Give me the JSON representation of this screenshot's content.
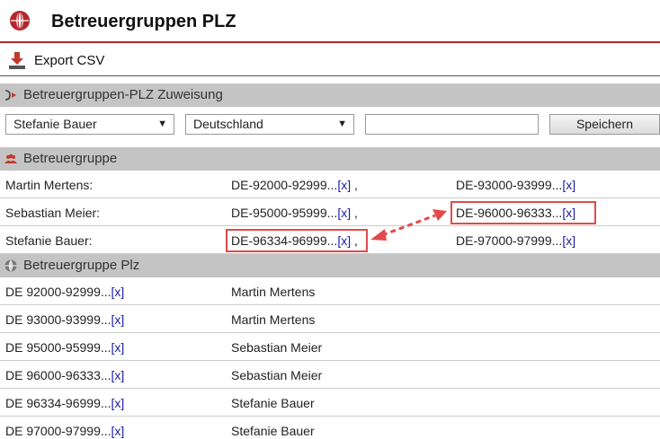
{
  "header": {
    "title": "Betreuergruppen PLZ"
  },
  "toolbar": {
    "export_label": "Export CSV"
  },
  "assign_section": {
    "label": "Betreuergruppen-PLZ Zuweisung"
  },
  "form": {
    "person_select": {
      "value": "Stefanie Bauer"
    },
    "country_select": {
      "value": "Deutschland"
    },
    "text_input": {
      "value": ""
    },
    "save_label": "Speichern"
  },
  "group_section": {
    "label": "Betreuergruppe",
    "rows": [
      {
        "name": "Martin Mertens:",
        "c1": "DE-92000-92999...",
        "c2": "DE-93000-93999..."
      },
      {
        "name": "Sebastian Meier:",
        "c1": "DE-95000-95999...",
        "c2": "DE-96000-96333..."
      },
      {
        "name": "Stefanie Bauer:",
        "c1": "DE-96334-96999...",
        "c2": "DE-97000-97999..."
      }
    ]
  },
  "plz_section": {
    "label": "Betreuergruppe Plz",
    "rows": [
      {
        "plz": "DE 92000-92999...",
        "person": "Martin Mertens"
      },
      {
        "plz": "DE 93000-93999...",
        "person": "Martin Mertens"
      },
      {
        "plz": "DE 95000-95999...",
        "person": "Sebastian Meier"
      },
      {
        "plz": "DE 96000-96333...",
        "person": "Sebastian Meier"
      },
      {
        "plz": "DE 96334-96999...",
        "person": "Stefanie Bauer"
      },
      {
        "plz": "DE 97000-97999...",
        "person": "Stefanie Bauer"
      }
    ]
  },
  "labels": {
    "remove": "[x]",
    "comma": ","
  },
  "icons": {
    "globe": "globe-icon",
    "export": "download-icon",
    "assign": "assign-arrow-icon",
    "group": "users-icon",
    "plz": "globe-small-icon",
    "dropdown": "triangle-down-icon"
  },
  "colors": {
    "accent": "#b4262b",
    "link": "#1a1aa6",
    "highlight": "#e34a4a",
    "section_bg": "#c4c4c4"
  }
}
